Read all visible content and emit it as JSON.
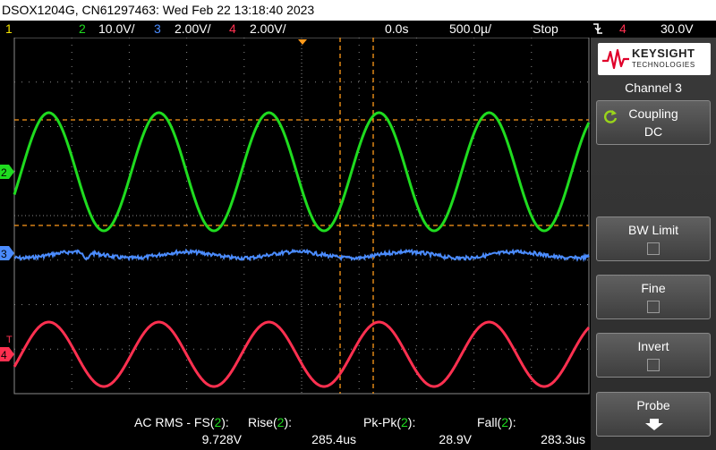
{
  "window": {
    "title": "DSOX1204G, CN61297463: Wed Feb 22 13:18:40 2023"
  },
  "status_bar": {
    "ch1_number": "1",
    "ch2_number": "2",
    "ch2_scale": "10.0V/",
    "ch3_number": "3",
    "ch3_scale": "2.00V/",
    "ch4_number": "4",
    "ch4_scale": "2.00V/",
    "time_delay": "0.0s",
    "time_scale": "500.0µ/",
    "run_state": "Stop",
    "trigger_icon": "trigger-edge-falling-icon",
    "trigger_source": "4",
    "trigger_level": "30.0V"
  },
  "colors": {
    "ch1": "#f5e400",
    "ch2": "#1fdc1f",
    "ch3": "#4b8cff",
    "ch4": "#ff3050",
    "cursor": "#ff9a1a",
    "grid": "#8a8a8a"
  },
  "markers": {
    "ch2": "2",
    "ch3": "3",
    "ch4": "4",
    "trigger_level_marker": "T"
  },
  "side_panel": {
    "brand": "KEYSIGHT",
    "brand_sub": "TECHNOLOGIES",
    "menu_title": "Channel 3",
    "softkeys": [
      {
        "label": "Coupling",
        "value": "DC",
        "icon": "cycle-arrow-icon"
      },
      {
        "label": "BW Limit",
        "checked": false
      },
      {
        "label": "Fine",
        "checked": false
      },
      {
        "label": "Invert",
        "checked": false
      },
      {
        "label": "Probe",
        "icon": "chevron-down-icon"
      }
    ]
  },
  "measurements": [
    {
      "label_prefix": "AC RMS - FS(",
      "source": "2",
      "label_suffix": "):",
      "value": "9.728V"
    },
    {
      "label_prefix": "Rise(",
      "source": "2",
      "label_suffix": "):",
      "value": "285.4us"
    },
    {
      "label_prefix": "Pk-Pk(",
      "source": "2",
      "label_suffix": "):",
      "value": "28.9V"
    },
    {
      "label_prefix": "Fall(",
      "source": "2",
      "label_suffix": "):",
      "value": "283.3us"
    }
  ]
}
